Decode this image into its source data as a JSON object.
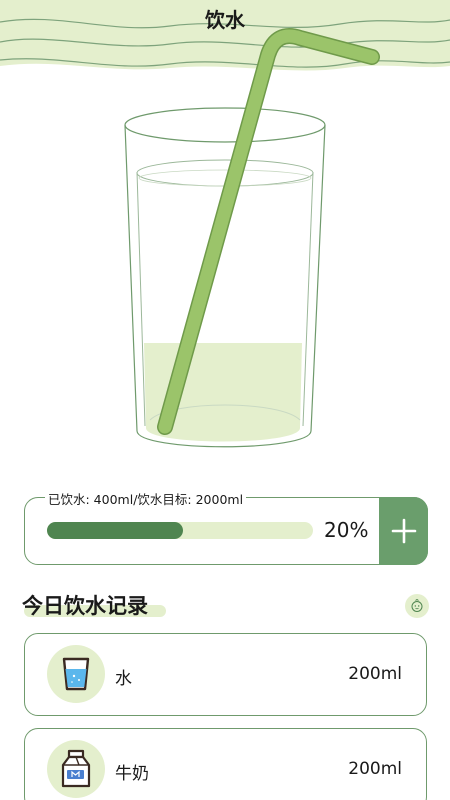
{
  "header": {
    "title": "饮水"
  },
  "progress": {
    "legend": "已饮水: 400ml/饮水目标: 2000ml",
    "fraction": 0.2,
    "percent_text": "20%",
    "add_icon": "plus-icon"
  },
  "records_section": {
    "title": "今日饮水记录",
    "action_icon": "face-icon"
  },
  "records": [
    {
      "name": "水",
      "amount": "200ml",
      "icon": "water-cup-icon"
    },
    {
      "name": "牛奶",
      "amount": "200ml",
      "icon": "milk-carton-icon"
    }
  ],
  "colors": {
    "accent": "#6a9e6c",
    "accent_dark": "#4f8550",
    "light_green": "#e4efcd",
    "straw": "#9bc46a",
    "water_blue": "#5bb7ec"
  }
}
